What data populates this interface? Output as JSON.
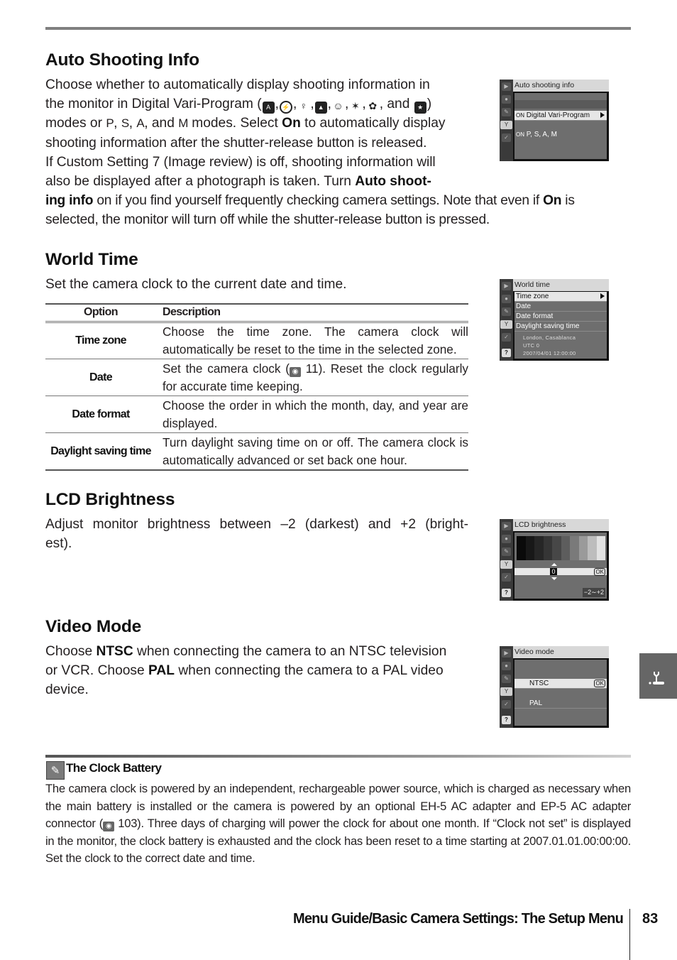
{
  "page": {
    "footer_title": "Menu Guide/Basic Camera Settings: The Setup Menu",
    "page_number": "83",
    "side_tab_icon": "setup-wrench-icon"
  },
  "auto_shooting_info": {
    "heading": "Auto Shooting Info",
    "line1": "Choose whether to automatically display shooting information in",
    "line2_pre": "the monitor in Digital Vari-Program (",
    "line2_post": ", and",
    "mode_icons": [
      "auto-mode-icon",
      "flash-off-mode-icon",
      "portrait-mode-icon",
      "landscape-mode-icon",
      "child-mode-icon",
      "sports-mode-icon",
      "close-up-mode-icon",
      "night-portrait-mode-icon"
    ],
    "line3_a": "modes or ",
    "modes": [
      "P",
      "S",
      "A",
      "M"
    ],
    "line3_b": " modes.  Select ",
    "on": "On",
    "line3_c": " to automatically display",
    "line4": "shooting information after the shutter-release button is released.",
    "line5": "If Custom Setting 7 (Image review) is off, shooting information will",
    "line6_a": "also be displayed after a photograph is taken.  Turn ",
    "line6_bold": "Auto shoot-",
    "line7_bold": "ing info",
    "line7_a": " on if you find yourself frequently checking camera settings.  Note that even if ",
    "line7_b": " is",
    "line8": "selected, the monitor will turn off while the shutter-release button is pressed.",
    "screen": {
      "title": "Auto shooting info",
      "rows": [
        {
          "flag": "ON",
          "label": "Digital Vari-Program",
          "selected": true
        },
        {
          "flag": "ON",
          "label": "P, S, A, M",
          "selected": false
        }
      ]
    }
  },
  "world_time": {
    "heading": "World Time",
    "intro": "Set the camera clock to the current date and time.",
    "table": {
      "headers": [
        "Option",
        "Description"
      ],
      "rows": [
        {
          "option": "Time zone",
          "description": "Choose the time zone.  The camera clock will automatically be reset to the time in the selected zone."
        },
        {
          "option": "Date",
          "description_pre": "Set the camera clock (",
          "ref_page": "11",
          "description_post": ").  Reset the clock regularly for accurate time keeping."
        },
        {
          "option": "Date format",
          "description": "Choose the order in which the month, day, and year are displayed."
        },
        {
          "option": "Daylight saving time",
          "description": "Turn daylight saving time on or off.  The camera clock is automatically advanced or set back one hour."
        }
      ]
    },
    "screen": {
      "title": "World time",
      "items": [
        "Time zone",
        "Date",
        "Date format",
        "Daylight saving time"
      ],
      "selected_index": 0,
      "info": [
        "London, Casablanca",
        "UTC 0",
        "2007/04/01 12:00:00"
      ]
    }
  },
  "lcd_brightness": {
    "heading": "LCD Brightness",
    "text": "Adjust monitor brightness between –2 (darkest) and +2 (bright-est).",
    "screen": {
      "title": "LCD brightness",
      "value": "0",
      "ok": "OK",
      "range": "−2∼+2",
      "gray_steps": [
        "#0a0a0a",
        "#181818",
        "#262626",
        "#353535",
        "#474747",
        "#5d5d5d",
        "#7a7a7a",
        "#9a9a9a",
        "#bdbdbd",
        "#e2e2e2"
      ]
    }
  },
  "video_mode": {
    "heading": "Video Mode",
    "t1": "Choose ",
    "ntsc": "NTSC",
    "t2": " when connecting the camera to an NTSC television or VCR.  Choose ",
    "pal": "PAL",
    "t3": " when connecting the camera to a PAL video device.",
    "screen": {
      "title": "Video mode",
      "options": [
        "NTSC",
        "PAL"
      ],
      "selected_index": 0,
      "ok": "OK"
    }
  },
  "note": {
    "icon": "pencil-note-icon",
    "title": "The Clock Battery",
    "body_pre": "The camera clock is powered by an independent, rechargeable power source, which is charged as necessary when the main battery is installed or the camera is powered by an optional EH-5 AC adapter and EP-5 AC adapter connector (",
    "ref_page": "103",
    "body_post": ").  Three days of charging will power the clock for about one month.  If “Clock not set” is displayed in the monitor, the clock battery is exhausted and the clock has been reset to a time starting at 2007.01.01.00:00:00.  Set the clock to the correct date and time."
  },
  "lcd_sidebar": {
    "icons": [
      "playback-menu-icon",
      "shooting-menu-icon",
      "custom-settings-icon",
      "setup-menu-icon",
      "retouch-menu-icon",
      "help-icon"
    ],
    "help_label": "?"
  }
}
